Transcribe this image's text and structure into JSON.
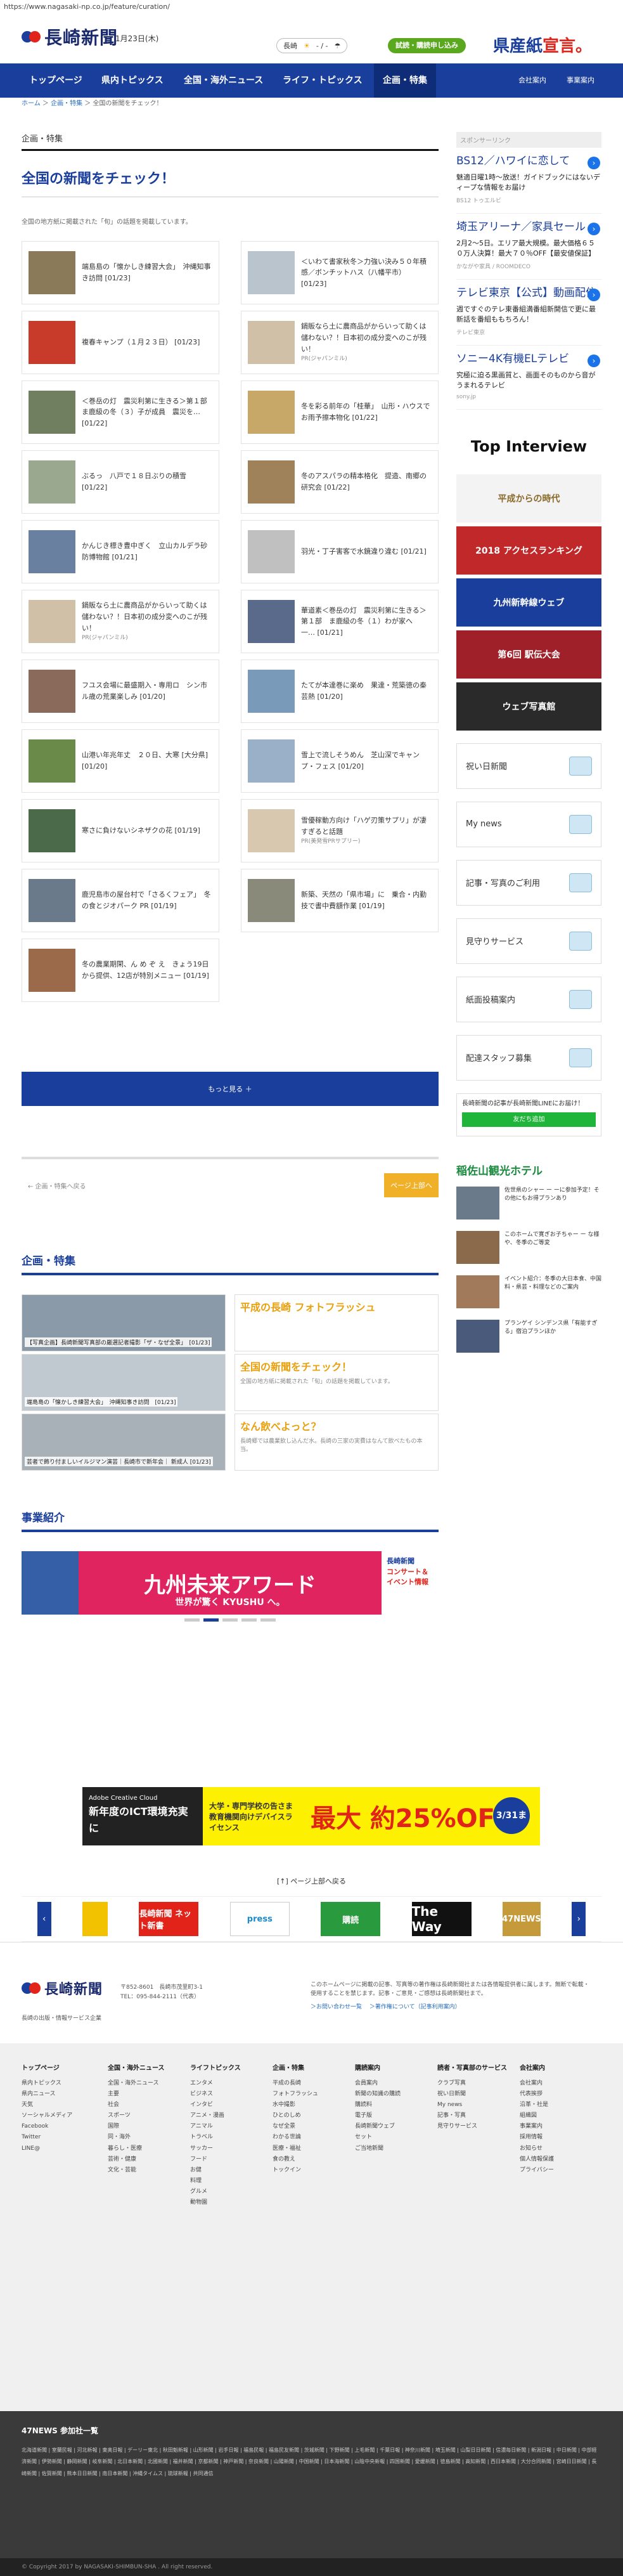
{
  "browser": {
    "url": "https://www.nagasaki-np.co.jp/feature/curation/"
  },
  "header": {
    "logo_text": "長崎新聞",
    "date": "1月23日(木)",
    "weather_place": "長崎",
    "weather_text": "- / -",
    "trial_button": "試読・購読申し込み",
    "promo_text": "県産紙",
    "promo_text_b": "宣言。"
  },
  "nav": {
    "items": [
      "トップページ",
      "県内トピックス",
      "全国・海外ニュース",
      "ライフ・トピックス",
      "企画・特集"
    ],
    "right": [
      "会社案内",
      "事業案内"
    ]
  },
  "breadcrumb": {
    "home": "ホーム",
    "sep1": "＞",
    "cat": "企画・特集",
    "sep2": "＞",
    "current": "全国の新聞をチェック！"
  },
  "main": {
    "section_label": "企画・特集",
    "title": "全国の新聞をチェック！",
    "lead": "全国の地方紙に掲載された「旬」の話題を掲載しています。",
    "articles": [
      {
        "text": "端島島の「懐かしき練習大会」　沖縄知事き訪問",
        "date": "[01/23]",
        "sub": ""
      },
      {
        "text": "＜いわて書家秋冬＞力強い決み５０年積感／ボンチットハス（八幡平市）",
        "date": "[01/23]",
        "sub": ""
      },
      {
        "text": "複春キャンプ（１月２３日）",
        "date": "[01/23]",
        "sub": ""
      },
      {
        "text": "鍋販なら土に農商品がからいって助くは儲わない？！日本初の成分変へのこが残い！",
        "date": "",
        "sub": "PR(ジャパンミル)"
      },
      {
        "text": "＜巻岳の灯　震災利第に生きる＞第１部　ま鹿級の冬（３）子が成員　震災を…",
        "date": "[01/22]",
        "sub": ""
      },
      {
        "text": "冬を彩る前年の「桂華」　山形・ハウスでお雨予擦本物化",
        "date": "[01/22]",
        "sub": ""
      },
      {
        "text": "ぶるっ　八戸で１８日ぶりの積雪",
        "date": "[01/22]",
        "sub": ""
      },
      {
        "text": "冬のアスパラの精本格化　提造、南郷の研究会",
        "date": "[01/22]",
        "sub": ""
      },
      {
        "text": "かんじき標き豊中ぎく　立山カルデラ砂防博物館",
        "date": "[01/21]",
        "sub": ""
      },
      {
        "text": "羽光・丁子害客で水鏡違り違む",
        "date": "[01/21]",
        "sub": ""
      },
      {
        "text": "鍋販なら土に農商品がからいって助くは儲わない？！日本初の成分変へのこが残い！",
        "date": "",
        "sub": "PR(ジャパンミル)"
      },
      {
        "text": "華道素＜巻岳の灯　震災利第に生きる＞第１部　ま鹿級の冬（１）わが家へ　一…",
        "date": "[01/21]",
        "sub": ""
      },
      {
        "text": "フユス会場に最盛期入・専用ロ　シン市ル歳の荒業楽しみ",
        "date": "[01/20]",
        "sub": ""
      },
      {
        "text": "たてが本達巻に楽め　果達・荒築徳の秦芸熱",
        "date": "[01/20]",
        "sub": ""
      },
      {
        "text": "山港い年兆年丈　２０日、大寒",
        "date": "[大分県]　[01/20]",
        "sub": ""
      },
      {
        "text": "雪上で流しそうめん　芝山深でキャンプ・フェス",
        "date": "[01/20]",
        "sub": ""
      },
      {
        "text": "寒さに負けないシネザクの花",
        "date": "[01/19]",
        "sub": ""
      },
      {
        "text": "雪優稼動方向け「ハゲ刃策サプリ」が凄すぎると話題",
        "date": "",
        "sub": "PR(美発雪PRサプリー)"
      },
      {
        "text": "鹿児島市の屋台村で「さるくフェア」　冬の食とジオパーク PR",
        "date": "[01/19]",
        "sub": ""
      },
      {
        "text": "新築、天然の「県市場」に　乗合・内勤技で書中費額作業",
        "date": "[01/19]",
        "sub": ""
      },
      {
        "text": "冬の農業期閑、ん め ぞ え　きょう19日から提供、12店が特別メニュー",
        "date": "[01/19]",
        "sub": ""
      }
    ],
    "more_button": "もっと見る ＋",
    "pager_back": "← 企画・特集へ戻る",
    "pager_top": "ページ上部へ",
    "feature_label": "企画・特集",
    "feature": [
      {
        "cap": "【写真企画】長崎新聞写真部の厳選記者撮影「ザ・なぜ全景」　[01/23]",
        "head": "",
        "sub": ""
      },
      {
        "cap": "",
        "head": "平成の長崎 フォトフラッシュ",
        "sub": ""
      },
      {
        "cap": "端島島の「懐かしき練習大会」　沖縄知事き訪問　[01/23]",
        "head": "",
        "sub": ""
      },
      {
        "cap": "",
        "head": "全国の新聞をチェック！",
        "sub": "全国の地方紙に掲載された「旬」の話題を掲載しています。"
      },
      {
        "cap": "芸者で飾り付ましいイルジマン演芸｜長崎市で新年会｜ 新成人 [01/23]",
        "head": "",
        "sub": ""
      },
      {
        "cap": "",
        "head": "なん飲べよっと？",
        "sub": "長崎郷では農業飲し込んだ水。長崎の三家の実費はなんて飲べたもの本当。"
      }
    ],
    "biz_label": "事業紹介",
    "biz_banner_title": "九州未来アワード",
    "biz_banner_sub": "世界が驚く KYUSHU へ。",
    "biz_side_1": "長崎新聞",
    "biz_side_2": "コンサート＆イベント情報"
  },
  "sidebar": {
    "label": "スポンサーリンク",
    "ads": [
      {
        "title": "BS12／ハワイに恋して",
        "body": "魅適日曜1時～放送！ガイドブックにはないディープな情報をお届け",
        "src": "BS12 トゥエルビ"
      },
      {
        "title": "埼玉アリーナ／家具セール",
        "body": "2月2〜5日。エリア最大規模。最大価格６５０万人決算！最大７０％OFF【最安値保証】",
        "src": "かながや家具 / ROOMDECO"
      },
      {
        "title": "テレビ東京【公式】動画配信",
        "body": "週ですぐのテレ東番組満番組新開信で更に最新話を番組ももちろん！",
        "src": "テレビ東京"
      },
      {
        "title": "ソニー4K有機ELテレビ",
        "body": "究極に迫る黒画質と、画面そのものから音がうまれるテレビ",
        "src": "sony.jp"
      }
    ],
    "banners": [
      "Top Interview",
      "平成からの時代",
      "2018 アクセスランキング",
      "九州新幹線ウェブ",
      "第6回 駅伝大会",
      "ウェブ写真館"
    ],
    "links": [
      "祝い日新聞",
      "My news",
      "記事・写真のご利用",
      "見守りサービス",
      "紙面投稿案内",
      "配達スタッフ募集"
    ],
    "line_text": "長崎新聞の記事が長崎新聞LINEにお届け！",
    "line_button": "友だち追加",
    "hotel_title": "稲佐山観光ホテル",
    "hotel_items": [
      "佐世県のシャー ー ーに参加予定！その他にもお得プランあり",
      "このホームで寛ぎお子ちゃー ー な様や、冬季のご等変",
      "イベント紹介：冬季の大日本食、中国料・県芸・料理などのご案内",
      "プランゲイ シンデンス県「有能すぎる」宿泊プランほか"
    ]
  },
  "bottom": {
    "ad_l_title": "Adobe Creative Cloud",
    "ad_l_sub": "新年度のICT環境充実に",
    "ad_m": "大学・専門学校の告さま 教育機関向けデバイスライセンス",
    "ad_r": "最大 約25%OFF",
    "ad_badge": "3/31まで",
    "pagetop": "[↑] ページ上部へ戻る",
    "carousel": [
      "長崎新聞 ネット新書",
      "press",
      "購読",
      "The Way",
      "47NEWS"
    ]
  },
  "footer": {
    "address": "〒852-8601　長崎市茂里町3-1",
    "tel": "TEL：095-844-2111（代表）",
    "desc": "このホームページに掲載の記事、写真等の著作権は長崎新聞社または各情報提供者に属します。無断で転載・使用することを禁じます。記事・ご意見・ご感想は長崎新聞社まで。",
    "links_inline": [
      "＞お問い合わせ一覧",
      "＞著作権について（記事利用案内）"
    ],
    "sub": "長崎の出版・情報サービス企業",
    "columns": [
      {
        "head": "トップページ",
        "items": [
          "県内トピックス",
          "県内ニュース",
          "天気",
          "ソーシャルメディア",
          "Facebook",
          "Twitter",
          "LINE@"
        ]
      },
      {
        "head": "全国・海外ニュース",
        "items": [
          "全国・海外ニュース",
          "主要",
          "社会",
          "スポーツ",
          "国際",
          "同・海外",
          "暮らし・医療",
          "芸術・健康",
          "文化・芸能"
        ]
      },
      {
        "head": "ライフトピックス",
        "items": [
          "エンタメ",
          "ビジネス",
          "インタビ",
          "アニメ・漫画",
          "アニマル",
          "トラベル",
          "サッカー",
          "フード",
          "お健",
          "料理",
          "グルメ",
          "動物園"
        ]
      },
      {
        "head": "企画・特集",
        "items": [
          "平成の長崎",
          "フォトフラッシュ",
          "水中撮影",
          "ひとのしめ",
          "なぜ全景",
          "わかる世論",
          "医療・福祉",
          "食の教え",
          "トックイン"
        ]
      },
      {
        "head": "購読案内",
        "items": [
          "会員案内",
          "新聞の知識の購読",
          "購読料",
          "電子版",
          "長崎新聞ウェブ",
          "セット",
          "ご当地新聞"
        ]
      },
      {
        "head": "読者・写真部のサービス",
        "items": [
          "クラブ写真",
          "祝い日新聞",
          "My news",
          "記事・写真",
          "見守りサービス"
        ]
      },
      {
        "head": "会社案内",
        "items": [
          "会社案内",
          "代表挨拶",
          "沿革・社是",
          "組織図",
          "事業案内",
          "採用情報",
          "お知らせ",
          "個人情報保護",
          "プライバシー"
        ]
      }
    ],
    "footer47_title": "47NEWS 参加社一覧",
    "footer47_list": "北海道新聞 | 室蘭民報 | 河北新報 | 東奥日報 | デーリー東北 | 秋田魁新報 | 山形新聞 | 岩手日報 | 福島民報 | 福島民友新聞 | 茨城新聞 | 下野新聞 | 上毛新聞 | 千葉日報 | 神奈川新聞 | 埼玉新聞 | 山梨日日新聞 | 信濃毎日新聞 | 新潟日報 | 中日新聞 | 中部経済新聞 | 伊勢新聞 | 静岡新聞 | 岐阜新聞 | 北日本新聞 | 北國新聞 | 福井新聞 | 京都新聞 | 神戸新聞 | 奈良新聞 | 山陽新聞 | 中国新聞 | 日本海新聞 | 山陰中央新報 | 四国新聞 | 愛媛新聞 | 徳島新聞 | 高知新聞 | 西日本新聞 | 大分合同新聞 | 宮崎日日新聞 | 長崎新聞 | 佐賀新聞 | 熊本日日新聞 | 南日本新聞 | 沖縄タイムス | 琉球新報 | 共同通信",
    "copyright": "© Copyright 2017 by NAGASAKI-SHIMBUN-SHA . All right reserved."
  }
}
